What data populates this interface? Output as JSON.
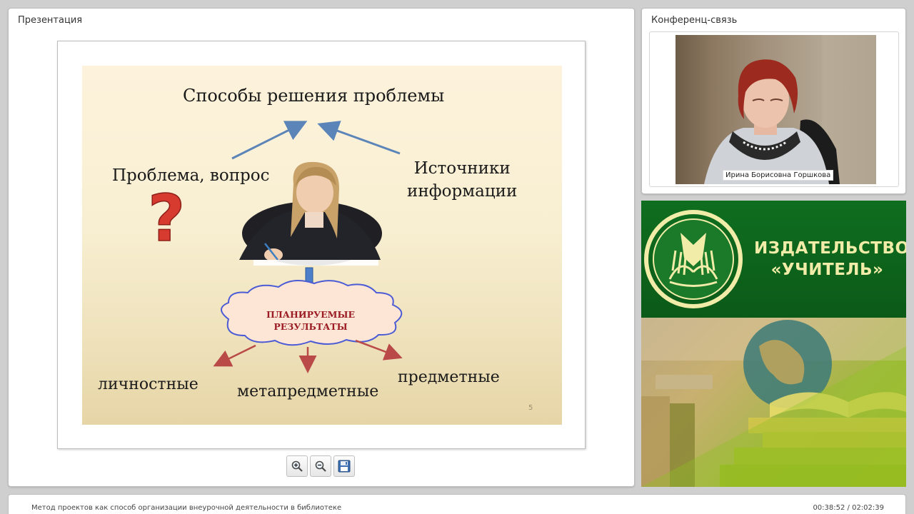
{
  "presentation": {
    "title": "Презентация",
    "slide": {
      "title": "Способы решения проблемы",
      "problem": "Проблема, вопрос",
      "sources_line1": "Источники",
      "sources_line2": "информации",
      "cloud_line1": "ПЛАНИРУЕМЫЕ",
      "cloud_line2": "РЕЗУЛЬТАТЫ",
      "result_personal": "личностные",
      "result_meta": "метапредметные",
      "result_subject": "предметные",
      "page_number": "5"
    },
    "toolbar": {
      "zoom_in_icon": "zoom-in-icon",
      "zoom_out_icon": "zoom-out-icon",
      "save_icon": "save-icon"
    }
  },
  "conference": {
    "title": "Конференц-связь",
    "speaker_name": "Ирина Борисовна Горшкова"
  },
  "publisher": {
    "name_line1": "ИЗДАТЕЛЬСТВО",
    "name_line2": "«УЧИТЕЛЬ»"
  },
  "status": {
    "session_title": "Метод проектов как способ организации внеурочной деятельности в библиотеке",
    "time": "00:38:52 / 02:02:39"
  },
  "colors": {
    "arrow_blue": "#5b84b8",
    "arrow_red": "#b94a48",
    "question_red": "#d73a2f",
    "cloud_border": "#4b5bd6",
    "cloud_fill": "#fde6d6",
    "banner_green": "#0f6e1f",
    "banner_text": "#f1eca8"
  }
}
